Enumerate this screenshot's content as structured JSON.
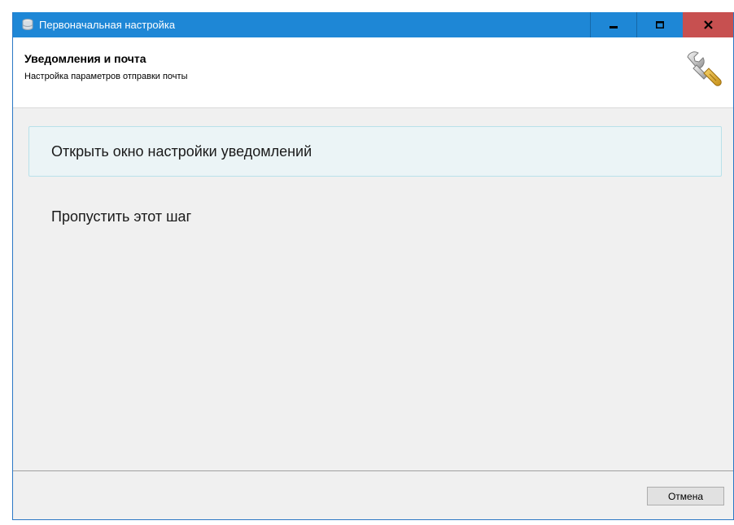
{
  "window": {
    "title": "Первоначальная настройка",
    "app_icon": "database-icon",
    "controls": {
      "minimize": "minimize-icon",
      "maximize": "maximize-icon",
      "close": "close-icon"
    },
    "colors": {
      "titlebar": "#1e87d6",
      "close_button": "#c75050",
      "body": "#f0f0f0"
    }
  },
  "header": {
    "title": "Уведомления и почта",
    "subtitle": "Настройка параметров отправки почты",
    "icon": "wrench-icon"
  },
  "options": [
    {
      "label": "Открыть окно настройки уведомлений",
      "highlighted": true
    },
    {
      "label": "Пропустить этот шаг",
      "highlighted": false
    }
  ],
  "footer": {
    "cancel_label": "Отмена"
  }
}
